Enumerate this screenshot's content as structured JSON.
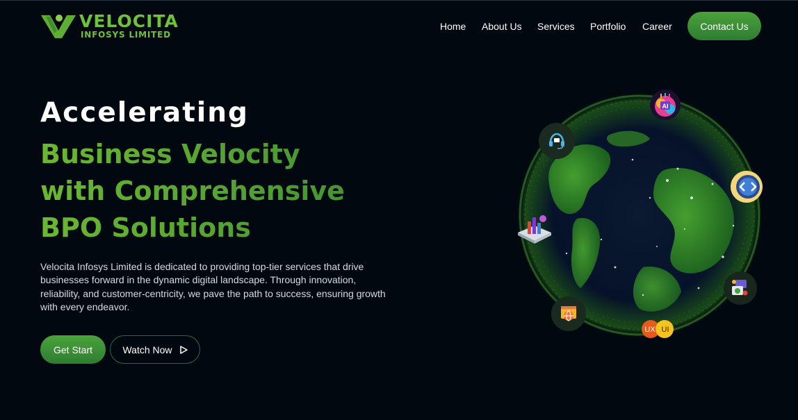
{
  "brand": {
    "name": "VELOCITA",
    "tagline": "INFOSYS LIMITED"
  },
  "nav": {
    "items": [
      "Home",
      "About Us",
      "Services",
      "Portfolio",
      "Career"
    ],
    "contact_label": "Contact Us"
  },
  "hero": {
    "line1": "Accelerating",
    "green_lines": [
      "Business Velocity",
      "with Comprehensive",
      "BPO Solutions"
    ],
    "description": "Velocita Infosys Limited is dedicated to providing top-tier services that drive businesses forward in the dynamic digital landscape. Through innovation, reliability, and customer-centricity, we pave the path to success, ensuring growth with every endeavor.",
    "cta_primary": "Get Start",
    "cta_secondary": "Watch Now"
  },
  "globe": {
    "icons": [
      {
        "name": "ai-brain-icon",
        "label": "AI"
      },
      {
        "name": "headset-support-icon",
        "label": ""
      },
      {
        "name": "code-icon",
        "label": ""
      },
      {
        "name": "analytics-chart-icon",
        "label": ""
      },
      {
        "name": "web-settings-icon",
        "label": ""
      },
      {
        "name": "web-globe-icon",
        "label": ""
      },
      {
        "name": "ux-ui-icon",
        "label_ux": "UX",
        "label_ui": "UI"
      }
    ]
  },
  "colors": {
    "background": "#020810",
    "accent_green": "#4aa33a",
    "heading_green": "#5fae33"
  }
}
